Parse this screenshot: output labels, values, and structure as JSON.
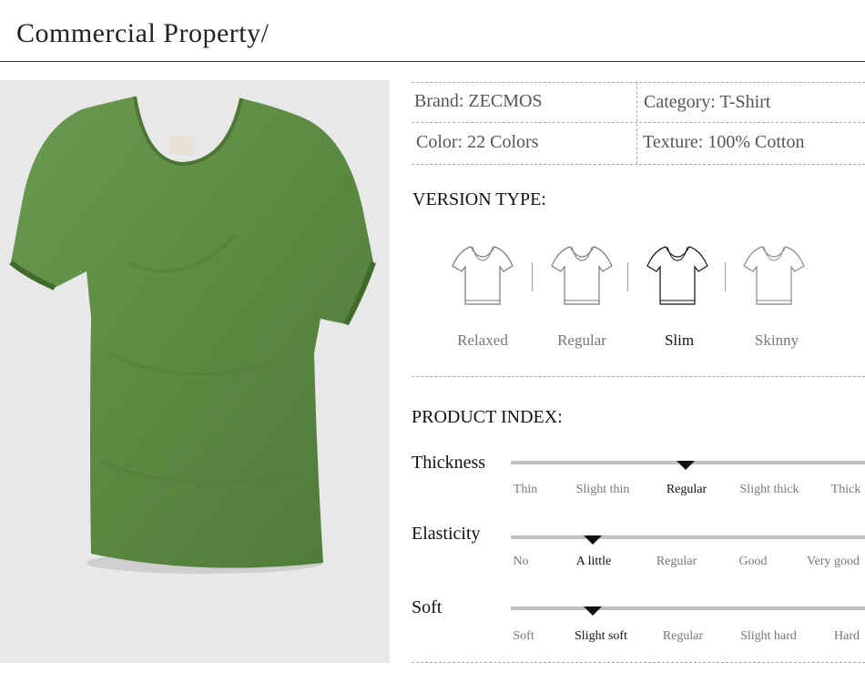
{
  "header": {
    "title": "Commercial Property/"
  },
  "specs": {
    "brand": "Brand: ZECMOS",
    "category": "Category:  T-Shirt",
    "color": "Color:  22 Colors",
    "texture": "Texture:  100% Cotton"
  },
  "version_type": {
    "heading": "VERSION TYPE:",
    "items": [
      {
        "label": "Relaxed",
        "selected": false
      },
      {
        "label": "Regular",
        "selected": false
      },
      {
        "label": "Slim",
        "selected": true
      },
      {
        "label": "Skinny",
        "selected": false
      }
    ]
  },
  "product_index": {
    "heading": "PRODUCT INDEX:",
    "rows": [
      {
        "name": "Thickness",
        "options": [
          "Thin",
          "Slight thin",
          "Regular",
          "Slight thick",
          "Thick"
        ],
        "selected": "Regular"
      },
      {
        "name": "Elasticity",
        "options": [
          "No",
          "A little",
          "Regular",
          "Good",
          "Very good"
        ],
        "selected": "A little"
      },
      {
        "name": "Soft",
        "options": [
          "Soft",
          "Slight soft",
          "Regular",
          "Slight hard",
          "Hard"
        ],
        "selected": "Slight soft"
      }
    ]
  },
  "colors": {
    "shirt": "#5e8c45",
    "track": "#c0c0c0",
    "photo_bg": "#e8e8e8"
  }
}
